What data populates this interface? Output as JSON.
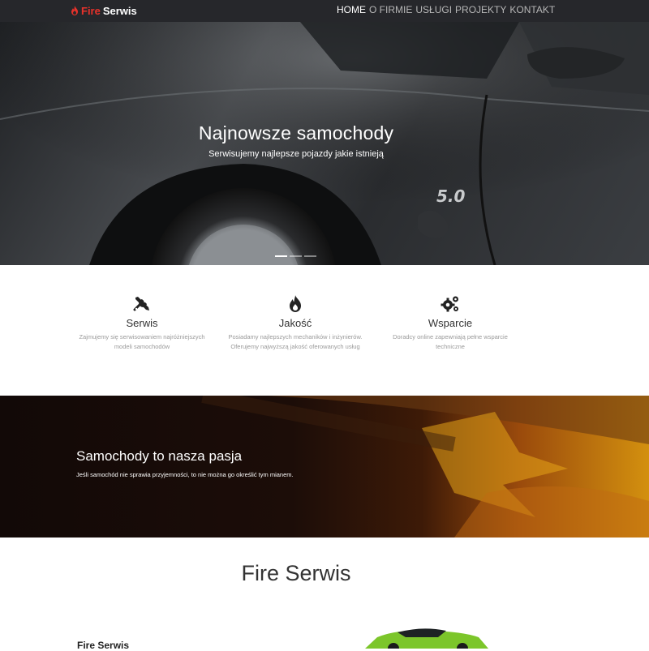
{
  "navbar": {
    "logo": {
      "icon": "fire-icon",
      "word1": "Fire",
      "word2": "Serwis",
      "accent_color": "#e8322b"
    },
    "links": [
      {
        "label": "HOME",
        "active": true
      },
      {
        "label": "O FIRMIE",
        "active": false
      },
      {
        "label": "USŁUGI",
        "active": false
      },
      {
        "label": "PROJEKTY",
        "active": false
      },
      {
        "label": "KONTAKT",
        "active": false
      }
    ]
  },
  "hero": {
    "title": "Najnowsze samochody",
    "subtitle": "Serwisujemy najlepsze pojazdy jakie istnieją",
    "slides": 3,
    "active_slide": 1
  },
  "features": [
    {
      "icon": "tools-icon",
      "title": "Serwis",
      "text": "Zajmujemy się serwisowaniem najróżniejszych modeli samochodów"
    },
    {
      "icon": "flame-icon",
      "title": "Jakość",
      "text": "Posiadamy najlepszych mechaników i inżynierów. Oferujemy najwyższą jakość oferowanych usług"
    },
    {
      "icon": "gears-icon",
      "title": "Wsparcie",
      "text": "Doradcy online zapewniają pełne wsparcie techniczne"
    }
  ],
  "banner": {
    "title": "Samochody to nasza pasja",
    "text": "Jeśli samochód nie sprawia przyjemności, to nie można go określić tym mianem."
  },
  "about": {
    "heading": "Fire Serwis",
    "subheading": "Fire Serwis"
  }
}
